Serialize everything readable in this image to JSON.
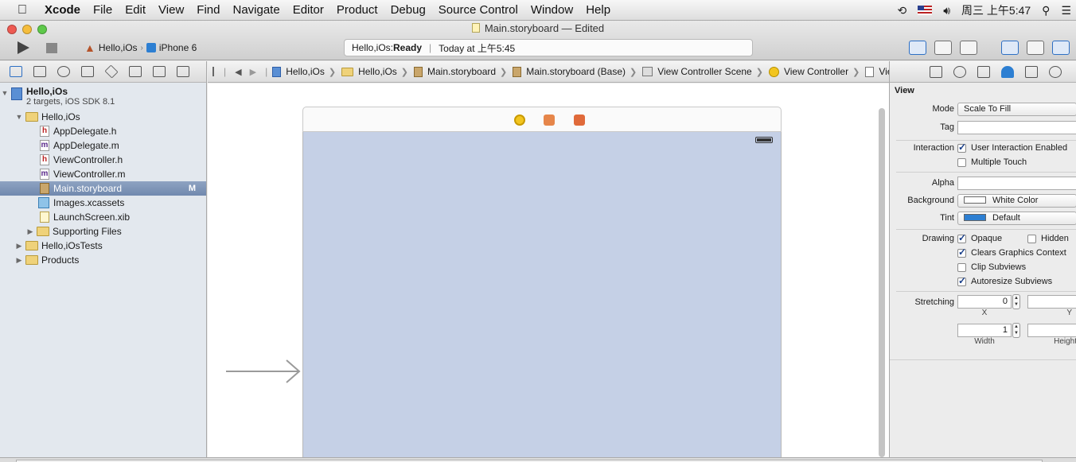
{
  "menubar": {
    "app_name": "Xcode",
    "items": [
      "File",
      "Edit",
      "View",
      "Find",
      "Navigate",
      "Editor",
      "Product",
      "Debug",
      "Source Control",
      "Window",
      "Help"
    ],
    "clock": "周三 上午5:47"
  },
  "window": {
    "title": "Main.storyboard — Edited"
  },
  "toolbar": {
    "scheme": "Hello,iOs",
    "device": "iPhone 6",
    "activity_project": "Hello,iOs: ",
    "activity_status": "Ready",
    "activity_time": "Today at 上午5:45"
  },
  "navigator": {
    "project": {
      "name": "Hello,iOs",
      "subtitle": "2 targets, iOS SDK 8.1"
    },
    "group": "Hello,iOs",
    "files": [
      {
        "name": "AppDelegate.h",
        "kind": "h"
      },
      {
        "name": "AppDelegate.m",
        "kind": "m"
      },
      {
        "name": "ViewController.h",
        "kind": "h"
      },
      {
        "name": "ViewController.m",
        "kind": "m"
      },
      {
        "name": "Main.storyboard",
        "kind": "storyboard",
        "badge": "M"
      },
      {
        "name": "Images.xcassets",
        "kind": "xcassets"
      },
      {
        "name": "LaunchScreen.xib",
        "kind": "xib"
      }
    ],
    "supporting": "Supporting Files",
    "tests": "Hello,iOsTests",
    "products": "Products"
  },
  "jumpbar": {
    "crumbs": [
      "Hello,iOs",
      "Hello,iOs",
      "Main.storyboard",
      "Main.storyboard (Base)",
      "View Controller Scene",
      "View Controller",
      "View"
    ]
  },
  "inspector": {
    "section": "View",
    "mode_label": "Mode",
    "mode_value": "Scale To Fill",
    "tag_label": "Tag",
    "interaction_label": "Interaction",
    "user_interaction": "User Interaction Enabled",
    "multiple_touch": "Multiple Touch",
    "alpha_label": "Alpha",
    "background_label": "Background",
    "background_value": "White Color",
    "tint_label": "Tint",
    "tint_value": "Default",
    "drawing_label": "Drawing",
    "opaque": "Opaque",
    "hidden": "Hidden",
    "clears": "Clears Graphics Context",
    "clip": "Clip Subviews",
    "autoresize": "Autoresize Subviews",
    "stretching_label": "Stretching",
    "stretch_x": "0",
    "stretch_width": "1",
    "x_label": "X",
    "y_label": "Y",
    "width_label": "Width",
    "height_label": "Height"
  },
  "colors": {
    "selection": "#7a8fb3",
    "canvas_view": "#c5d0e6",
    "tint": "#2d7fd2"
  }
}
